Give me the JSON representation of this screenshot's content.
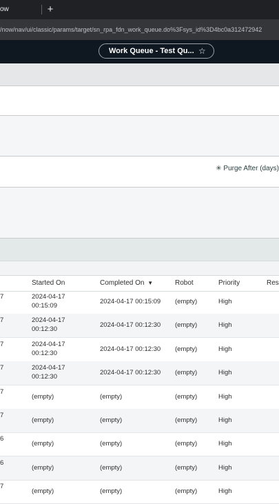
{
  "browser": {
    "tab_title": "ow",
    "new_tab_label": "+",
    "url": "/now/nav/ui/classic/params/target/sn_rpa_fdn_work_queue.do%3Fsys_id%3D4bc0a312472942"
  },
  "header": {
    "record_title": "Work Queue - Test Qu...",
    "favorite_icon": "star-icon"
  },
  "form": {
    "purge_label": "Purge After (days)",
    "purge_marker": "✳"
  },
  "table": {
    "columns": {
      "first": "",
      "started_on": "Started On",
      "completed_on": "Completed On",
      "sort_indicator": "▼",
      "robot": "Robot",
      "priority": "Priority",
      "resp": "Resp"
    },
    "rows": [
      {
        "first": "7",
        "started_date": "2024-04-17",
        "started_time": "00:15:09",
        "completed": "2024-04-17 00:15:09",
        "robot": "(empty)",
        "priority": "High"
      },
      {
        "first": "7",
        "started_date": "2024-04-17",
        "started_time": "00:12:30",
        "completed": "2024-04-17 00:12:30",
        "robot": "(empty)",
        "priority": "High"
      },
      {
        "first": "7",
        "started_date": "2024-04-17",
        "started_time": "00:12:30",
        "completed": "2024-04-17 00:12:30",
        "robot": "(empty)",
        "priority": "High"
      },
      {
        "first": "7",
        "started_date": "2024-04-17",
        "started_time": "00:12:30",
        "completed": "2024-04-17 00:12:30",
        "robot": "(empty)",
        "priority": "High"
      },
      {
        "first": "7",
        "started": "(empty)",
        "completed": "(empty)",
        "robot": "(empty)",
        "priority": "High"
      },
      {
        "first": "7",
        "started": "(empty)",
        "completed": "(empty)",
        "robot": "(empty)",
        "priority": "High"
      },
      {
        "first": "6",
        "started": "(empty)",
        "completed": "(empty)",
        "robot": "(empty)",
        "priority": "High"
      },
      {
        "first": "6",
        "started": "(empty)",
        "completed": "(empty)",
        "robot": "(empty)",
        "priority": "High"
      },
      {
        "first": "7",
        "started": "(empty)",
        "completed": "(empty)",
        "robot": "(empty)",
        "priority": "High"
      }
    ]
  }
}
